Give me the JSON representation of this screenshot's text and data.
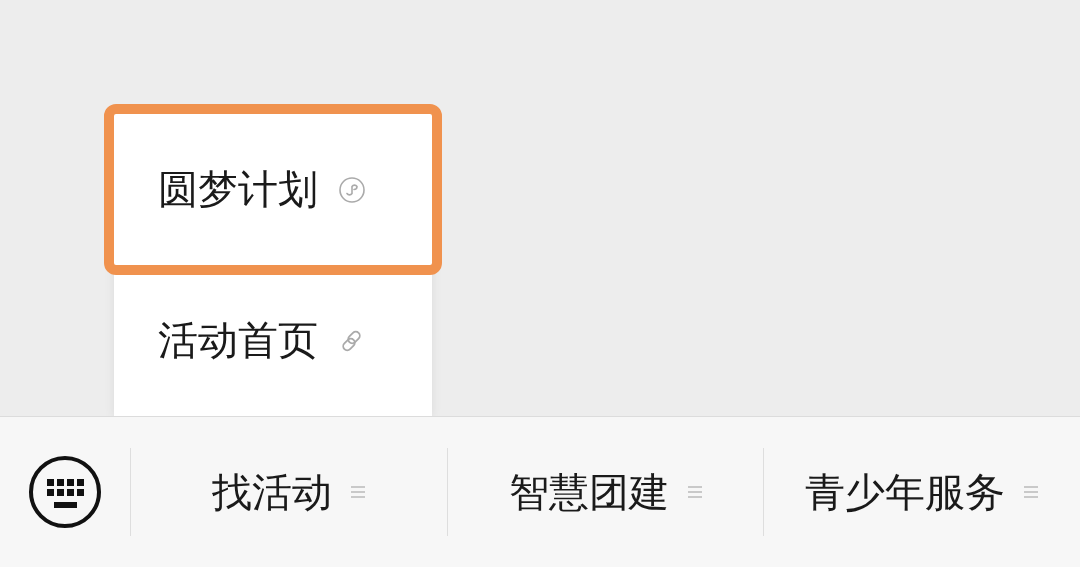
{
  "popup_menu": {
    "items": [
      {
        "label": "圆梦计划",
        "kind": "miniprogram",
        "highlighted": true
      },
      {
        "label": "活动首页",
        "kind": "link",
        "highlighted": false
      }
    ]
  },
  "bottom_bar": {
    "tabs": [
      {
        "label": "找活动"
      },
      {
        "label": "智慧团建"
      },
      {
        "label": "青少年服务"
      }
    ]
  }
}
